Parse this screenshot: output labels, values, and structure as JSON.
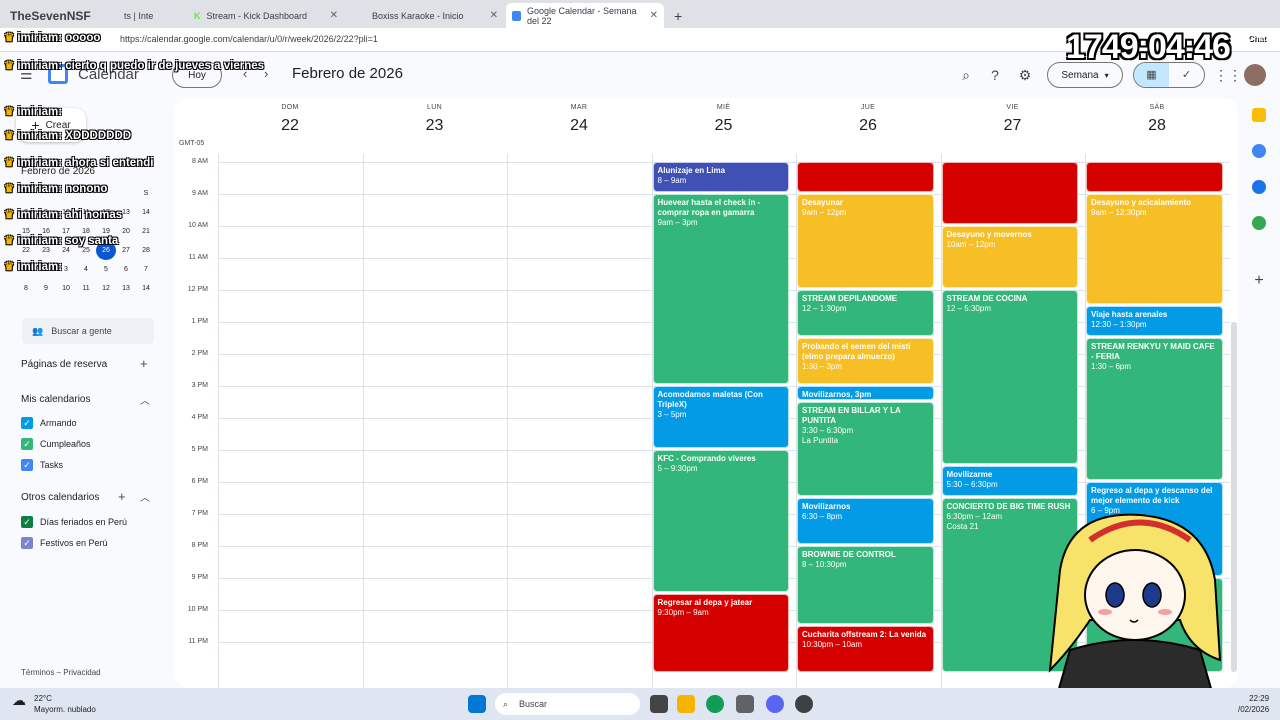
{
  "browser": {
    "tabs": [
      {
        "label": "TheSevenNSF",
        "active": false
      },
      {
        "label": "ts | Inte",
        "active": false
      },
      {
        "label": "Stream - Kick Dashboard",
        "active": false
      },
      {
        "label": "Boxiss Karaoke - Inicio",
        "active": false
      },
      {
        "label": "Google Calendar - Semana del 22",
        "active": true
      }
    ],
    "url": "https://calendar.google.com/calendar/u/0/r/week/2026/2/22?pli=1"
  },
  "calendar": {
    "app_title": "Calendar",
    "today_button": "Hoy",
    "month_label": "Febrero de 2026",
    "view_select": "Semana",
    "timezone": "GMT-05",
    "days": [
      {
        "name": "DOM",
        "num": "22"
      },
      {
        "name": "LUN",
        "num": "23"
      },
      {
        "name": "MAR",
        "num": "24"
      },
      {
        "name": "MIÉ",
        "num": "25"
      },
      {
        "name": "JUE",
        "num": "26"
      },
      {
        "name": "VIE",
        "num": "27"
      },
      {
        "name": "SÁB",
        "num": "28"
      }
    ],
    "hours": [
      "8 AM",
      "9 AM",
      "10 AM",
      "11 AM",
      "12 PM",
      "1 PM",
      "2 PM",
      "3 PM",
      "4 PM",
      "5 PM",
      "6 PM",
      "7 PM",
      "8 PM",
      "9 PM",
      "10 PM",
      "11 PM"
    ],
    "events": [
      {
        "day": 3,
        "start": 8,
        "end": 9,
        "title": "Alunizaje en Lima",
        "time": "8 – 9am",
        "extra": "",
        "color": "#3f51b5"
      },
      {
        "day": 3,
        "start": 9,
        "end": 15,
        "title": "Huevear hasta el check in - comprar ropa en gamarra",
        "time": "9am – 3pm",
        "extra": "",
        "color": "#33b679"
      },
      {
        "day": 3,
        "start": 15,
        "end": 17,
        "title": "Acomodamos maletas (Con TripleX)",
        "time": "3 – 5pm",
        "extra": "",
        "color": "#039be5"
      },
      {
        "day": 3,
        "start": 17,
        "end": 21.5,
        "title": "KFC - Comprando víveres",
        "time": "5 – 9:30pm",
        "extra": "",
        "color": "#33b679"
      },
      {
        "day": 3,
        "start": 21.5,
        "end": 24,
        "title": "Regresar al depa y jatear",
        "time": "9:30pm – 9am",
        "extra": "",
        "color": "#d50000"
      },
      {
        "day": 4,
        "start": 8,
        "end": 9,
        "title": "",
        "time": "",
        "extra": "",
        "color": "#d50000"
      },
      {
        "day": 4,
        "start": 9,
        "end": 12,
        "title": "Desayunar",
        "time": "9am – 12pm",
        "extra": "",
        "color": "#f6bf26"
      },
      {
        "day": 4,
        "start": 12,
        "end": 13.5,
        "title": "STREAM DEPILANDOME",
        "time": "12 – 1:30pm",
        "extra": "",
        "color": "#33b679"
      },
      {
        "day": 4,
        "start": 13.5,
        "end": 15,
        "title": "Probando el semen del misti (elmo prepara almuerzo)",
        "time": "1:30 – 3pm",
        "extra": "",
        "color": "#f6bf26"
      },
      {
        "day": 4,
        "start": 15,
        "end": 15.5,
        "title": "Movilizarnos, 3pm",
        "time": "",
        "extra": "",
        "color": "#039be5"
      },
      {
        "day": 4,
        "start": 15.5,
        "end": 18.5,
        "title": "STREAM EN BILLAR Y LA PUNTITA",
        "time": "3:30 – 6:30pm",
        "extra": "La Puntita",
        "color": "#33b679"
      },
      {
        "day": 4,
        "start": 18.5,
        "end": 20,
        "title": "Movilizarnos",
        "time": "6:30 – 8pm",
        "extra": "",
        "color": "#039be5"
      },
      {
        "day": 4,
        "start": 20,
        "end": 22.5,
        "title": "BROWNIE DE CONTROL",
        "time": "8 – 10:30pm",
        "extra": "",
        "color": "#33b679"
      },
      {
        "day": 4,
        "start": 22.5,
        "end": 24,
        "title": "Cucharita offstream 2: La venida",
        "time": "10:30pm – 10am",
        "extra": "",
        "color": "#d50000"
      },
      {
        "day": 5,
        "start": 8,
        "end": 10,
        "title": "",
        "time": "",
        "extra": "",
        "color": "#d50000"
      },
      {
        "day": 5,
        "start": 10,
        "end": 12,
        "title": "Desayuno y movernos",
        "time": "10am – 12pm",
        "extra": "",
        "color": "#f6bf26"
      },
      {
        "day": 5,
        "start": 12,
        "end": 17.5,
        "title": "STREAM DE COCINA",
        "time": "12 – 5:30pm",
        "extra": "",
        "color": "#33b679"
      },
      {
        "day": 5,
        "start": 17.5,
        "end": 18.5,
        "title": "Movilizarme",
        "time": "5:30 – 6:30pm",
        "extra": "",
        "color": "#039be5"
      },
      {
        "day": 5,
        "start": 18.5,
        "end": 24,
        "title": "CONCIERTO DE BIG TIME RUSH",
        "time": "6:30pm – 12am",
        "extra": "Costa 21",
        "color": "#33b679"
      },
      {
        "day": 6,
        "start": 8,
        "end": 9,
        "title": "",
        "time": "",
        "extra": "",
        "color": "#d50000"
      },
      {
        "day": 6,
        "start": 9,
        "end": 12.5,
        "title": "Desayuno y acicalamiento",
        "time": "9am – 12:30pm",
        "extra": "",
        "color": "#f6bf26"
      },
      {
        "day": 6,
        "start": 12.5,
        "end": 13.5,
        "title": "Viaje hasta arenales",
        "time": "12:30 – 1:30pm",
        "extra": "",
        "color": "#039be5"
      },
      {
        "day": 6,
        "start": 13.5,
        "end": 18,
        "title": "STREAM RENKYU Y MAID CAFE - FERIA",
        "time": "1:30 – 6pm",
        "extra": "",
        "color": "#33b679"
      },
      {
        "day": 6,
        "start": 18,
        "end": 21,
        "title": "Regreso al depa y descanso del mejor elemento de kick",
        "time": "6 – 9pm",
        "extra": "",
        "color": "#039be5"
      },
      {
        "day": 6,
        "start": 21,
        "end": 24,
        "title": "flores",
        "time": "",
        "extra": "",
        "color": "#33b679"
      }
    ]
  },
  "sidebar": {
    "create_label": "Crear",
    "mini_title": "Febrero de 2026",
    "mini_rows": [
      [
        "",
        "",
        "",
        "",
        "",
        "",
        "S"
      ],
      [
        "8",
        "9",
        "10",
        "11",
        "12",
        "13",
        "14"
      ],
      [
        "15",
        "16",
        "17",
        "18",
        "19",
        "20",
        "21"
      ],
      [
        "22",
        "23",
        "24",
        "25",
        "26",
        "27",
        "28"
      ],
      [
        "1",
        "2",
        "3",
        "4",
        "5",
        "6",
        "7"
      ],
      [
        "8",
        "9",
        "10",
        "11",
        "12",
        "13",
        "14"
      ]
    ],
    "search_people": "Buscar a gente",
    "booking_pages": "Páginas de reserva",
    "my_calendars": "Mis calendarios",
    "my_items": [
      {
        "label": "Armando",
        "color": "#039be5"
      },
      {
        "label": "Cumpleaños",
        "color": "#33b679"
      },
      {
        "label": "Tasks",
        "color": "#4285f4"
      }
    ],
    "other_calendars": "Otros calendarios",
    "other_items": [
      {
        "label": "Días feriados en Perú",
        "color": "#0b8043"
      },
      {
        "label": "Festivos en Perú",
        "color": "#7986cb"
      }
    ],
    "footer": "Términos – Privacidad"
  },
  "overlay": {
    "timer": "1749:04:46",
    "chat_button": "Chat",
    "chat_lines": [
      {
        "text": "imiriam: ooooo"
      },
      {
        "text": "imiriam: cierto q puedo ir de jueves a viernes"
      },
      {
        "text": "imiriam:"
      },
      {
        "text": "imiriam: XDDDDDDD"
      },
      {
        "text": "imiriam: ahora si entendi"
      },
      {
        "text": "imiriam: nonono"
      },
      {
        "text": "imiriam: ahi nomas"
      },
      {
        "text": "imiriam: soy santa"
      },
      {
        "text": "imiriam:"
      }
    ]
  },
  "taskbar": {
    "weather_temp": "22°C",
    "weather_desc": "Mayorm. nublado",
    "search": "Buscar",
    "time": "22:29",
    "date": "/02/2026"
  }
}
